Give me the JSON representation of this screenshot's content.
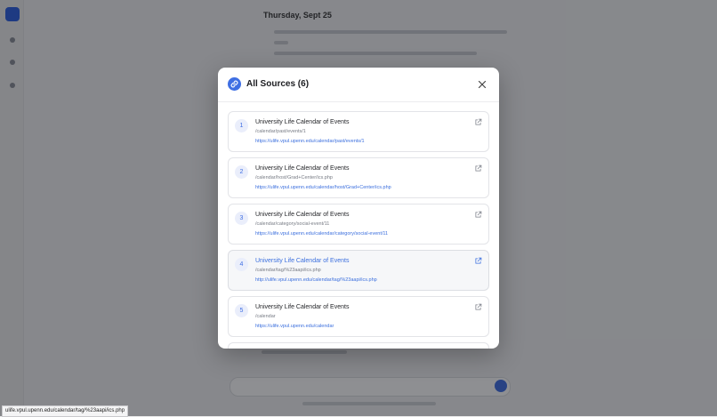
{
  "modal": {
    "title": "All Sources (6)"
  },
  "sources": [
    {
      "number": "1",
      "title": "University Life Calendar of Events",
      "path": "/calendar/past/events/1",
      "url": "https://ulife.vpul.upenn.edu/calendar/past/events/1"
    },
    {
      "number": "2",
      "title": "University Life Calendar of Events",
      "path": "/calendar/host/Grad+Center/ics.php",
      "url": "https://ulife.vpul.upenn.edu/calendar/host/Grad+Center/ics.php"
    },
    {
      "number": "3",
      "title": "University Life Calendar of Events",
      "path": "/calendar/category/social-event/11",
      "url": "https://ulife.vpul.upenn.edu/calendar/category/social-event/11"
    },
    {
      "number": "4",
      "title": "University Life Calendar of Events",
      "path": "/calendar/tag/%23aapi/ics.php",
      "url": "http://ulife.vpul.upenn.edu/calendar/tag/%23aapi/ics.php"
    },
    {
      "number": "5",
      "title": "University Life Calendar of Events",
      "path": "/calendar",
      "url": "https://ulife.vpul.upenn.edu/calendar"
    }
  ],
  "background": {
    "date_heading": "Thursday, Sept 25"
  },
  "status_bar": {
    "link_preview": "ulife.vpul.upenn.edu/calendar/tag/%23aapi/ics.php"
  },
  "icons": {
    "header": "link-icon",
    "close": "close-icon",
    "external": "external-link-icon"
  },
  "colors": {
    "accent": "#3f6fe3",
    "link": "#3b6fde",
    "hover_card": "#f6f7f9"
  }
}
